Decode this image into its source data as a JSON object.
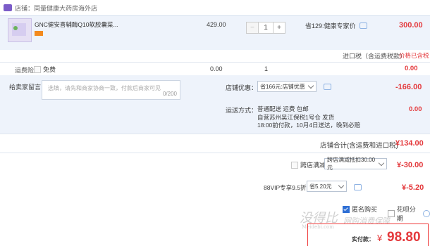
{
  "store": {
    "icon": "store-icon",
    "label": "店铺：同量健康大药房海外店"
  },
  "item": {
    "title": "GNC健安喜辅酶Q10软胶囊菜...",
    "unit_price": "429.00",
    "quantity": "1",
    "promo": "省129:健康专家价",
    "subtotal": "300.00",
    "import_tax_label": "进口税（含运费税款）",
    "import_tax_value": "价格已含税"
  },
  "freight_insurance": {
    "label": "运费险",
    "option_label": "免费",
    "price": "0.00",
    "qty": "1",
    "total": "0.00"
  },
  "message": {
    "label": "给卖家留言：",
    "placeholder": "选填，请先和商家协商一致，付款后商家可见",
    "counter": "0/200"
  },
  "store_discount": {
    "label": "店铺优惠：",
    "selected": "省166元:店铺优惠",
    "amount": "-166.00"
  },
  "shipping": {
    "label": "运送方式：",
    "method": "普通配送 运费 包邮",
    "origin": "自营苏州吴江保税1号仓  发货",
    "eta": "18:00前付款，10月4日送达，晚到必赔",
    "cost": "0.00"
  },
  "store_total": {
    "label": "店铺合计(含运费和进口税)",
    "value": "¥134.00"
  },
  "cross_store": {
    "label": "跨店满减",
    "selected": "跨店满减抵扣30.00元",
    "amount": "¥-30.00"
  },
  "vip": {
    "label": "88VIP专享9.5折",
    "selected": "省5.20元",
    "amount": "¥-5.20"
  },
  "anonymous": {
    "label": "匿名购买",
    "checked": true
  },
  "huabei": {
    "label": "花呗分期"
  },
  "payment": {
    "label": "实付款：",
    "currency": "¥",
    "amount": "98.80"
  },
  "watermark": {
    "text": "没得比",
    "subtext": "Meidebi.com",
    "right_text": "网购消费保障"
  },
  "colors": {
    "accent_red": "#e4393c",
    "panel_bg": "#eef3fb",
    "pay_border": "#ef3a3a",
    "check_blue": "#2f6fd4"
  }
}
